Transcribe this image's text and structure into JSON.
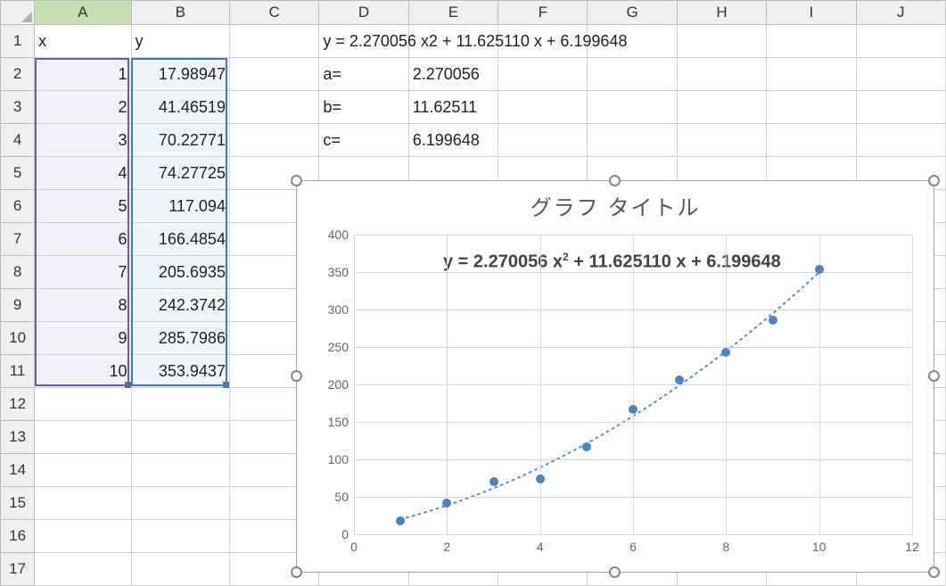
{
  "columns": [
    "A",
    "B",
    "C",
    "D",
    "E",
    "F",
    "G",
    "H",
    "I",
    "J"
  ],
  "row_count": 17,
  "active_column": "A",
  "headers": {
    "x": "x",
    "y": "y"
  },
  "table": {
    "x": [
      1,
      2,
      3,
      4,
      5,
      6,
      7,
      8,
      9,
      10
    ],
    "y": [
      "17.98947",
      "41.46519",
      "70.22771",
      "74.27725",
      "117.094",
      "166.4854",
      "205.6935",
      "242.3742",
      "285.7986",
      "353.9437"
    ]
  },
  "formula_line": "y = 2.270056 x2 + 11.625110 x + 6.199648",
  "coeffs": {
    "a_label": "a=",
    "a_val": "2.270056",
    "b_label": "b=",
    "b_val": "11.62511",
    "c_label": "c=",
    "c_val": "6.199648"
  },
  "chart": {
    "title": "グラフ タイトル",
    "equation_prefix": "y = 2.270056 x",
    "equation_sup": "2",
    "equation_suffix": " + 11.625110 x + 6.199648"
  },
  "chart_data": {
    "type": "scatter",
    "title": "グラフ タイトル",
    "xlabel": "",
    "ylabel": "",
    "xlim": [
      0,
      12
    ],
    "ylim": [
      0,
      400
    ],
    "x_ticks": [
      0,
      2,
      4,
      6,
      8,
      10,
      12
    ],
    "y_ticks": [
      0,
      50,
      100,
      150,
      200,
      250,
      300,
      350,
      400
    ],
    "x": [
      1,
      2,
      3,
      4,
      5,
      6,
      7,
      8,
      9,
      10
    ],
    "y": [
      17.98947,
      41.46519,
      70.22771,
      74.27725,
      117.094,
      166.4854,
      205.6935,
      242.3742,
      285.7986,
      353.9437
    ],
    "trend": {
      "type": "polynomial",
      "degree": 2,
      "a": 2.270056,
      "b": 11.62511,
      "c": 6.199648
    },
    "annotation": "y = 2.270056 x² + 11.625110 x + 6.199648"
  }
}
